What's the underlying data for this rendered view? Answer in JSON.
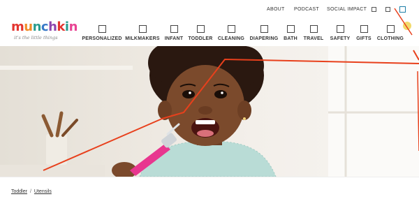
{
  "top_links": [
    "ABOUT",
    "PODCAST",
    "SOCIAL IMPACT"
  ],
  "top_icons": [
    "account-icon",
    "cart-icon",
    "search-icon"
  ],
  "logo": {
    "word": "munchkin",
    "tagline": "it's the little things"
  },
  "nav": [
    "PERSONALIZED",
    "MILKMAKERS",
    "INFANT",
    "TODDLER",
    "CLEANING",
    "DIAPERING",
    "BATH",
    "TRAVEL",
    "SAFETY",
    "GIFTS",
    "CLOTHING"
  ],
  "breadcrumb": [
    "Toddler",
    "Utensils"
  ],
  "breadcrumb_separator": "/",
  "colors": {
    "logo_letters": [
      "#e3342f",
      "#f28c28",
      "#2a9d8f",
      "#3a7ac8",
      "#8e44ad",
      "#e3342f",
      "#2a9d8f",
      "#e84393"
    ],
    "annotation_line": "#e8401c",
    "active_icon": "#1e7fa8",
    "utensil_pink": "#e8368f"
  }
}
